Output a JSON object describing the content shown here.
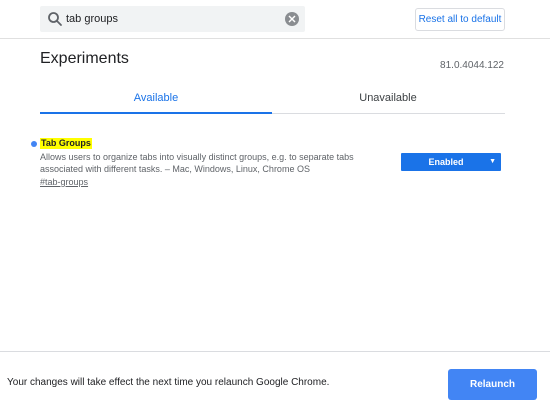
{
  "search": {
    "value": "tab groups",
    "icon": "search-icon",
    "clear_icon": "clear-icon"
  },
  "header": {
    "reset_label": "Reset all to default"
  },
  "main": {
    "title": "Experiments",
    "version": "81.0.4044.122",
    "tabs": [
      {
        "label": "Available",
        "active": true
      },
      {
        "label": "Unavailable",
        "active": false
      }
    ]
  },
  "experiments": [
    {
      "name": "Tab Groups",
      "description": "Allows users to organize tabs into visually distinct groups, e.g. to separate tabs associated with different tasks. – Mac, Windows, Linux, Chrome OS",
      "link": "#tab-groups",
      "selected": "Enabled",
      "indicator_color": "#4285f4"
    }
  ],
  "footer": {
    "message": "Your changes will take effect the next time you relaunch Google Chrome.",
    "relaunch_label": "Relaunch"
  },
  "colors": {
    "accent": "#1a73e8",
    "highlight": "#ffff00",
    "relaunch": "#4285f4"
  }
}
